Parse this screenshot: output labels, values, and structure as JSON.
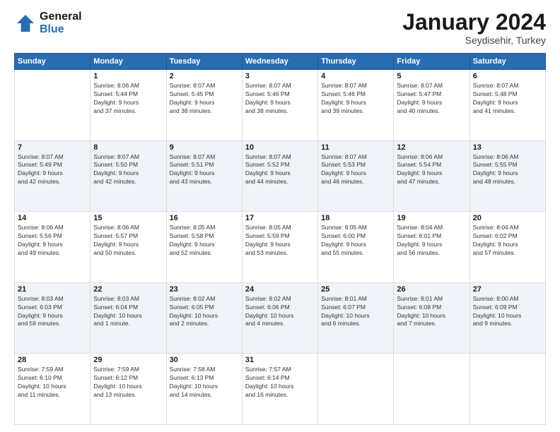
{
  "header": {
    "logo_line1": "General",
    "logo_line2": "Blue",
    "month": "January 2024",
    "location": "Seydisehir, Turkey"
  },
  "weekdays": [
    "Sunday",
    "Monday",
    "Tuesday",
    "Wednesday",
    "Thursday",
    "Friday",
    "Saturday"
  ],
  "weeks": [
    [
      {
        "day": "",
        "info": ""
      },
      {
        "day": "1",
        "info": "Sunrise: 8:06 AM\nSunset: 5:44 PM\nDaylight: 9 hours\nand 37 minutes."
      },
      {
        "day": "2",
        "info": "Sunrise: 8:07 AM\nSunset: 5:45 PM\nDaylight: 9 hours\nand 38 minutes."
      },
      {
        "day": "3",
        "info": "Sunrise: 8:07 AM\nSunset: 5:46 PM\nDaylight: 9 hours\nand 38 minutes."
      },
      {
        "day": "4",
        "info": "Sunrise: 8:07 AM\nSunset: 5:46 PM\nDaylight: 9 hours\nand 39 minutes."
      },
      {
        "day": "5",
        "info": "Sunrise: 8:07 AM\nSunset: 5:47 PM\nDaylight: 9 hours\nand 40 minutes."
      },
      {
        "day": "6",
        "info": "Sunrise: 8:07 AM\nSunset: 5:48 PM\nDaylight: 9 hours\nand 41 minutes."
      }
    ],
    [
      {
        "day": "7",
        "info": "Sunrise: 8:07 AM\nSunset: 5:49 PM\nDaylight: 9 hours\nand 42 minutes."
      },
      {
        "day": "8",
        "info": "Sunrise: 8:07 AM\nSunset: 5:50 PM\nDaylight: 9 hours\nand 42 minutes."
      },
      {
        "day": "9",
        "info": "Sunrise: 8:07 AM\nSunset: 5:51 PM\nDaylight: 9 hours\nand 43 minutes."
      },
      {
        "day": "10",
        "info": "Sunrise: 8:07 AM\nSunset: 5:52 PM\nDaylight: 9 hours\nand 44 minutes."
      },
      {
        "day": "11",
        "info": "Sunrise: 8:07 AM\nSunset: 5:53 PM\nDaylight: 9 hours\nand 46 minutes."
      },
      {
        "day": "12",
        "info": "Sunrise: 8:06 AM\nSunset: 5:54 PM\nDaylight: 9 hours\nand 47 minutes."
      },
      {
        "day": "13",
        "info": "Sunrise: 8:06 AM\nSunset: 5:55 PM\nDaylight: 9 hours\nand 48 minutes."
      }
    ],
    [
      {
        "day": "14",
        "info": "Sunrise: 8:06 AM\nSunset: 5:56 PM\nDaylight: 9 hours\nand 49 minutes."
      },
      {
        "day": "15",
        "info": "Sunrise: 8:06 AM\nSunset: 5:57 PM\nDaylight: 9 hours\nand 50 minutes."
      },
      {
        "day": "16",
        "info": "Sunrise: 8:05 AM\nSunset: 5:58 PM\nDaylight: 9 hours\nand 52 minutes."
      },
      {
        "day": "17",
        "info": "Sunrise: 8:05 AM\nSunset: 5:59 PM\nDaylight: 9 hours\nand 53 minutes."
      },
      {
        "day": "18",
        "info": "Sunrise: 8:05 AM\nSunset: 6:00 PM\nDaylight: 9 hours\nand 55 minutes."
      },
      {
        "day": "19",
        "info": "Sunrise: 8:04 AM\nSunset: 6:01 PM\nDaylight: 9 hours\nand 56 minutes."
      },
      {
        "day": "20",
        "info": "Sunrise: 8:04 AM\nSunset: 6:02 PM\nDaylight: 9 hours\nand 57 minutes."
      }
    ],
    [
      {
        "day": "21",
        "info": "Sunrise: 8:03 AM\nSunset: 6:03 PM\nDaylight: 9 hours\nand 59 minutes."
      },
      {
        "day": "22",
        "info": "Sunrise: 8:03 AM\nSunset: 6:04 PM\nDaylight: 10 hours\nand 1 minute."
      },
      {
        "day": "23",
        "info": "Sunrise: 8:02 AM\nSunset: 6:05 PM\nDaylight: 10 hours\nand 2 minutes."
      },
      {
        "day": "24",
        "info": "Sunrise: 8:02 AM\nSunset: 6:06 PM\nDaylight: 10 hours\nand 4 minutes."
      },
      {
        "day": "25",
        "info": "Sunrise: 8:01 AM\nSunset: 6:07 PM\nDaylight: 10 hours\nand 6 minutes."
      },
      {
        "day": "26",
        "info": "Sunrise: 8:01 AM\nSunset: 6:08 PM\nDaylight: 10 hours\nand 7 minutes."
      },
      {
        "day": "27",
        "info": "Sunrise: 8:00 AM\nSunset: 6:09 PM\nDaylight: 10 hours\nand 9 minutes."
      }
    ],
    [
      {
        "day": "28",
        "info": "Sunrise: 7:59 AM\nSunset: 6:10 PM\nDaylight: 10 hours\nand 11 minutes."
      },
      {
        "day": "29",
        "info": "Sunrise: 7:59 AM\nSunset: 6:12 PM\nDaylight: 10 hours\nand 13 minutes."
      },
      {
        "day": "30",
        "info": "Sunrise: 7:58 AM\nSunset: 6:13 PM\nDaylight: 10 hours\nand 14 minutes."
      },
      {
        "day": "31",
        "info": "Sunrise: 7:57 AM\nSunset: 6:14 PM\nDaylight: 10 hours\nand 16 minutes."
      },
      {
        "day": "",
        "info": ""
      },
      {
        "day": "",
        "info": ""
      },
      {
        "day": "",
        "info": ""
      }
    ]
  ]
}
